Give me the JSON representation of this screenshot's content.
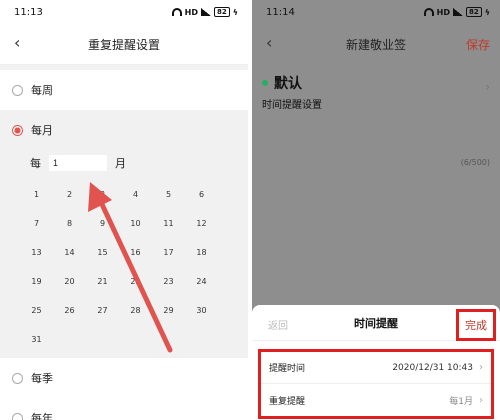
{
  "left": {
    "status": {
      "time": "11:13",
      "network": "HD",
      "battery": "82"
    },
    "header": {
      "title": "重复提醒设置",
      "back_icon": "‹"
    },
    "options": {
      "weekly": "每周",
      "monthly": "每月",
      "quarterly": "每季",
      "yearly": "每年"
    },
    "every": {
      "prefix": "每",
      "value": "1",
      "suffix": "月"
    },
    "days": [
      1,
      2,
      3,
      4,
      5,
      6,
      7,
      8,
      9,
      10,
      11,
      12,
      13,
      14,
      15,
      16,
      17,
      18,
      19,
      20,
      21,
      22,
      23,
      24,
      25,
      26,
      27,
      28,
      29,
      30,
      31
    ],
    "accent_color": "#e0534f"
  },
  "right": {
    "status": {
      "time": "11:14",
      "network": "HD",
      "battery": "82"
    },
    "header": {
      "title": "新建敬业签",
      "save": "保存",
      "back_icon": "‹"
    },
    "note": {
      "title": "默认",
      "subtitle": "时间提醒设置",
      "counter": "(6/500)"
    },
    "sheet": {
      "back": "返回",
      "title": "时间提醒",
      "done": "完成",
      "rows": [
        {
          "label": "提醒时间",
          "value": "2020/12/31 10:43"
        },
        {
          "label": "重复提醒",
          "value": "每1月"
        }
      ]
    },
    "highlight_color": "#e02020"
  }
}
